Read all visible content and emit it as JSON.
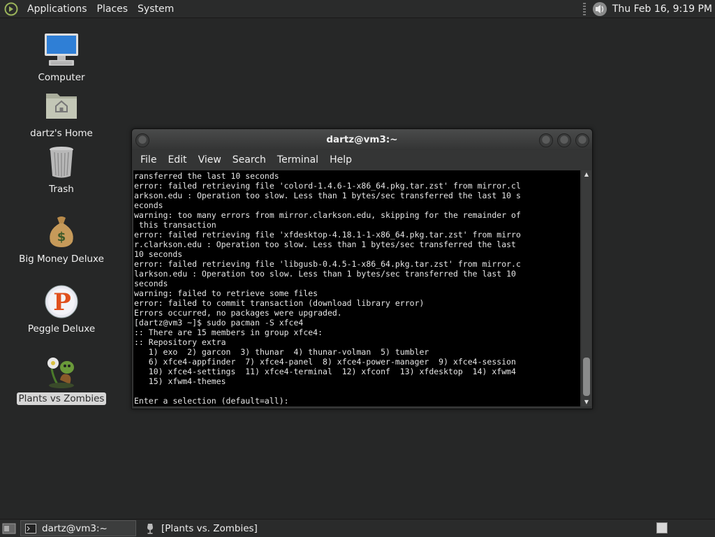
{
  "top_panel": {
    "menus": [
      "Applications",
      "Places",
      "System"
    ],
    "clock": "Thu Feb 16,  9:19 PM",
    "icons": {
      "logo": "distro-logo-icon",
      "volume": "volume-icon"
    }
  },
  "desktop": {
    "icons": [
      {
        "label": "Computer",
        "icon": "computer-icon"
      },
      {
        "label": "dartz's Home",
        "icon": "home-folder-icon"
      },
      {
        "label": "Trash",
        "icon": "trash-icon"
      },
      {
        "label": "Big Money Deluxe",
        "icon": "money-bag-icon"
      },
      {
        "label": "Peggle Deluxe",
        "icon": "peggle-icon"
      },
      {
        "label": "Plants vs Zombies",
        "icon": "plants-vs-zombies-icon",
        "selected": true
      }
    ]
  },
  "terminal": {
    "title": "dartz@vm3:~",
    "menu": [
      "File",
      "Edit",
      "View",
      "Search",
      "Terminal",
      "Help"
    ],
    "lines": [
      "ransferred the last 10 seconds",
      "error: failed retrieving file 'colord-1.4.6-1-x86_64.pkg.tar.zst' from mirror.cl",
      "arkson.edu : Operation too slow. Less than 1 bytes/sec transferred the last 10 s",
      "econds",
      "warning: too many errors from mirror.clarkson.edu, skipping for the remainder of",
      " this transaction",
      "error: failed retrieving file 'xfdesktop-4.18.1-1-x86_64.pkg.tar.zst' from mirro",
      "r.clarkson.edu : Operation too slow. Less than 1 bytes/sec transferred the last",
      "10 seconds",
      "error: failed retrieving file 'libgusb-0.4.5-1-x86_64.pkg.tar.zst' from mirror.c",
      "larkson.edu : Operation too slow. Less than 1 bytes/sec transferred the last 10",
      "seconds",
      "warning: failed to retrieve some files",
      "error: failed to commit transaction (download library error)",
      "Errors occurred, no packages were upgraded.",
      "[dartz@vm3 ~]$ sudo pacman -S xfce4",
      ":: There are 15 members in group xfce4:",
      ":: Repository extra",
      "   1) exo  2) garcon  3) thunar  4) thunar-volman  5) tumbler",
      "   6) xfce4-appfinder  7) xfce4-panel  8) xfce4-power-manager  9) xfce4-session",
      "   10) xfce4-settings  11) xfce4-terminal  12) xfconf  13) xfdesktop  14) xfwm4",
      "   15) xfwm4-themes",
      "",
      "Enter a selection (default=all): "
    ],
    "scroll_position": 0.85
  },
  "bottom_panel": {
    "tasks": [
      {
        "label": "dartz@vm3:~",
        "icon": "terminal-icon",
        "active": true
      },
      {
        "label": "[Plants vs. Zombies]",
        "icon": "wine-icon",
        "active": false
      }
    ],
    "icons": {
      "show_desktop": "show-desktop-icon",
      "workspace": "workspace-switcher-icon"
    }
  }
}
